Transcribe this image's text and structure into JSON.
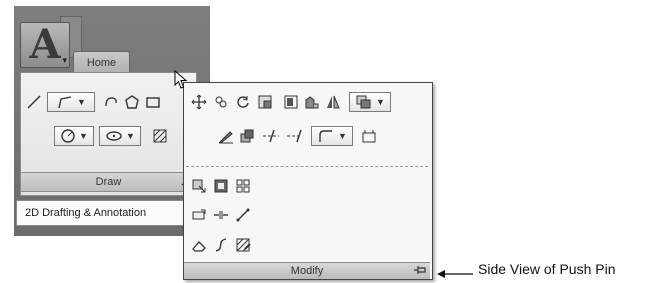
{
  "ribbon": {
    "tab_home": "Home",
    "draw_panel": {
      "title": "Draw",
      "icons": [
        "line-icon",
        "polyline-icon",
        "arc-icon",
        "polygon-icon",
        "rectangle-icon",
        "circle-icon",
        "ellipse-icon",
        "hatch-icon"
      ]
    },
    "workspace": {
      "selected": "2D Drafting & Annotation"
    }
  },
  "modify_panel": {
    "title": "Modify",
    "row1": [
      "move-icon",
      "copy-icon",
      "rotate-icon",
      "scale-icon",
      "array-icon",
      "mirror-icon",
      "mirror-line-icon",
      "draworder-icon"
    ],
    "row2": [
      "edit-icon",
      "fillet-icon",
      "trim-icon",
      "extend-icon",
      "fillet-corner-icon",
      "explode-icon"
    ],
    "extended": [
      "stretch-icon",
      "offset-icon",
      "array-rect-icon",
      "lengthen-icon",
      "break-icon",
      "join-icon",
      "erase-icon",
      "spline-edit-icon",
      "hatch-edit-icon"
    ]
  },
  "annotation": {
    "label": "Side View of Push Pin"
  }
}
